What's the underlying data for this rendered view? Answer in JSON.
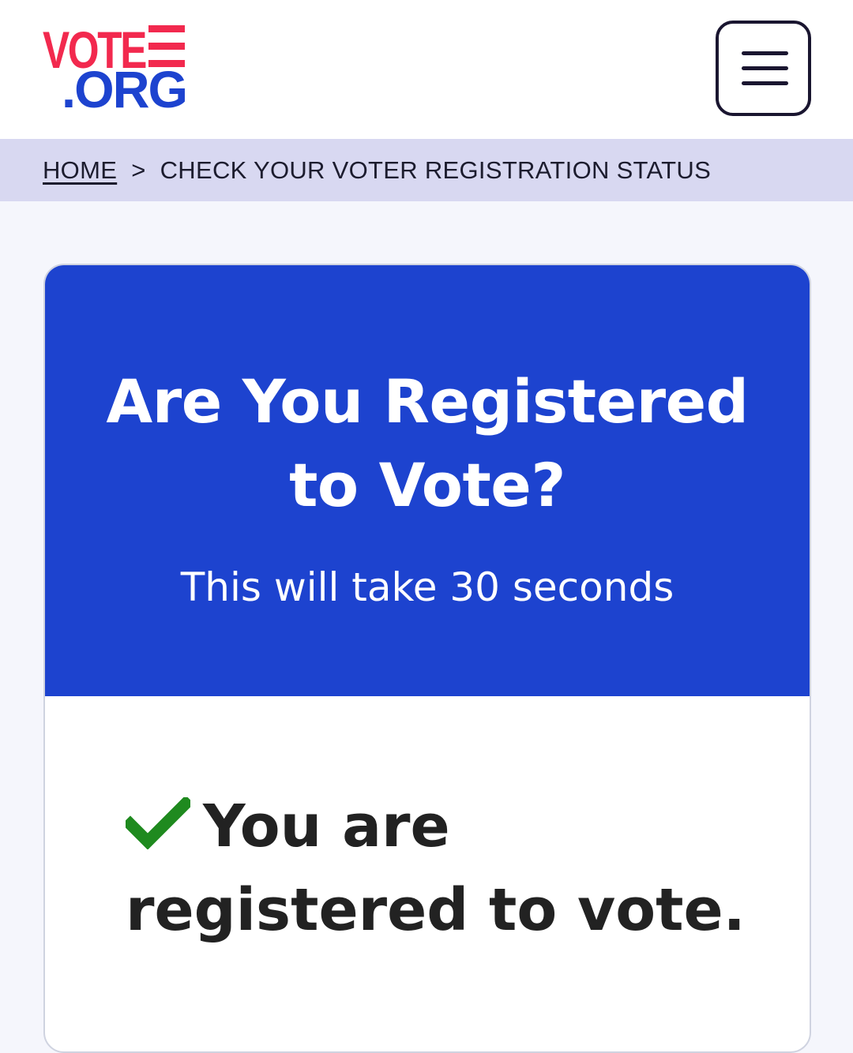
{
  "header": {
    "logo_top": "VOTE",
    "logo_bottom": ".ORG",
    "menu_icon": "hamburger-menu-icon"
  },
  "breadcrumb": {
    "home_label": "HOME",
    "separator": ">",
    "current_label": "CHECK YOUR VOTER REGISTRATION STATUS"
  },
  "card": {
    "title": "Are You Registered to Vote?",
    "subtitle": "This will take 30 seconds",
    "result_icon": "checkmark-icon",
    "result_text": "You are registered to vote."
  },
  "colors": {
    "brand_blue": "#1d43cf",
    "brand_red": "#f2294e",
    "success_green": "#1f8a1f",
    "breadcrumb_bg": "#d8d8f1"
  }
}
